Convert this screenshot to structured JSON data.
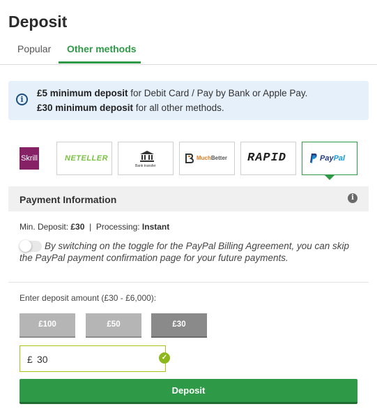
{
  "page": {
    "title": "Deposit"
  },
  "tabs": [
    {
      "label": "Popular",
      "active": false
    },
    {
      "label": "Other methods",
      "active": true
    }
  ],
  "info": {
    "line1_bold": "£5 minimum deposit",
    "line1_rest": " for Debit Card / Pay by Bank or Apple Pay.",
    "line2_bold": "£30 minimum deposit",
    "line2_rest": " for all other methods."
  },
  "payment_methods": [
    {
      "name": "Skrill",
      "label": "Skrill",
      "selected": false
    },
    {
      "name": "Neteller",
      "label": "NETELLER",
      "selected": false
    },
    {
      "name": "Bank Transfer",
      "label": "Bank transfer",
      "selected": false
    },
    {
      "name": "MuchBetter",
      "label_1": "Much",
      "label_2": "Better",
      "selected": false
    },
    {
      "name": "Rapid",
      "label": "RAPID",
      "selected": false
    },
    {
      "name": "PayPal",
      "label_1": "Pay",
      "label_2": "Pal",
      "selected": true
    }
  ],
  "payment_info": {
    "title": "Payment Information",
    "min_deposit_label": "Min. Deposit:",
    "min_deposit_value": "£30",
    "separator": "|",
    "processing_label": "Processing:",
    "processing_value": "Instant",
    "toggle_on": false,
    "toggle_text": "By switching on the toggle for the PayPal Billing Agreement, you can skip the PayPal payment confirmation page for your future payments."
  },
  "amount": {
    "label": "Enter deposit amount (£30 - £6,000):",
    "quick_amounts": [
      "£100",
      "£50",
      "£30"
    ],
    "selected_quick": "£30",
    "currency_symbol": "£",
    "value": "30"
  },
  "deposit_button": {
    "label": "Deposit"
  },
  "colors": {
    "accent": "#2e9a47",
    "info_bg": "#e6f0fa",
    "valid": "#8cb81c",
    "skrill": "#862165",
    "paypal_dark": "#253b80",
    "paypal_light": "#179bd7"
  }
}
